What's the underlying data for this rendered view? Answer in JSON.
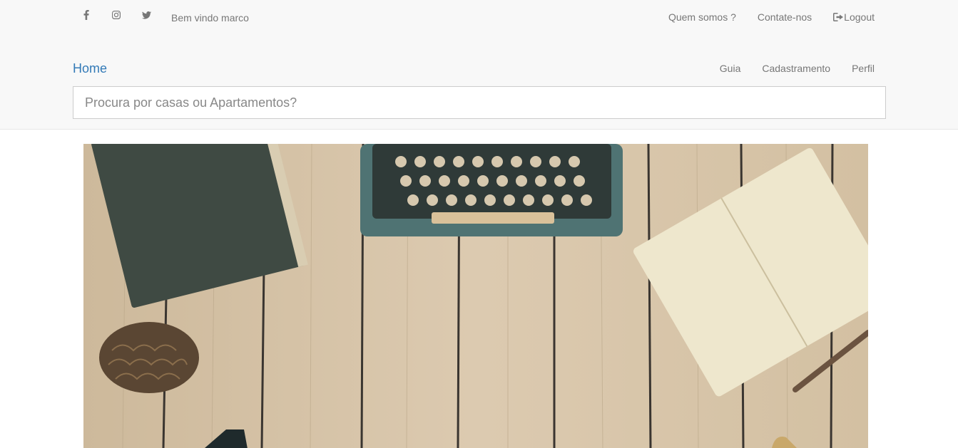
{
  "topbar": {
    "social": [
      {
        "icon": "facebook-icon"
      },
      {
        "icon": "instagram-icon"
      },
      {
        "icon": "twitter-icon"
      }
    ],
    "welcome": "Bem vindo marco",
    "links": {
      "about": "Quem somos ?",
      "contact": "Contate-nos",
      "logout": "Logout"
    }
  },
  "navbar": {
    "brand": "Home",
    "items": [
      "Guia",
      "Cadastramento",
      "Perfil"
    ]
  },
  "search": {
    "placeholder": "Procura por casas ou Apartamentos?"
  },
  "hero": {
    "description_icon": "desk-photo-image"
  },
  "colors": {
    "brand": "#337ab7",
    "muted": "#777777",
    "header_bg": "#f8f8f8"
  }
}
